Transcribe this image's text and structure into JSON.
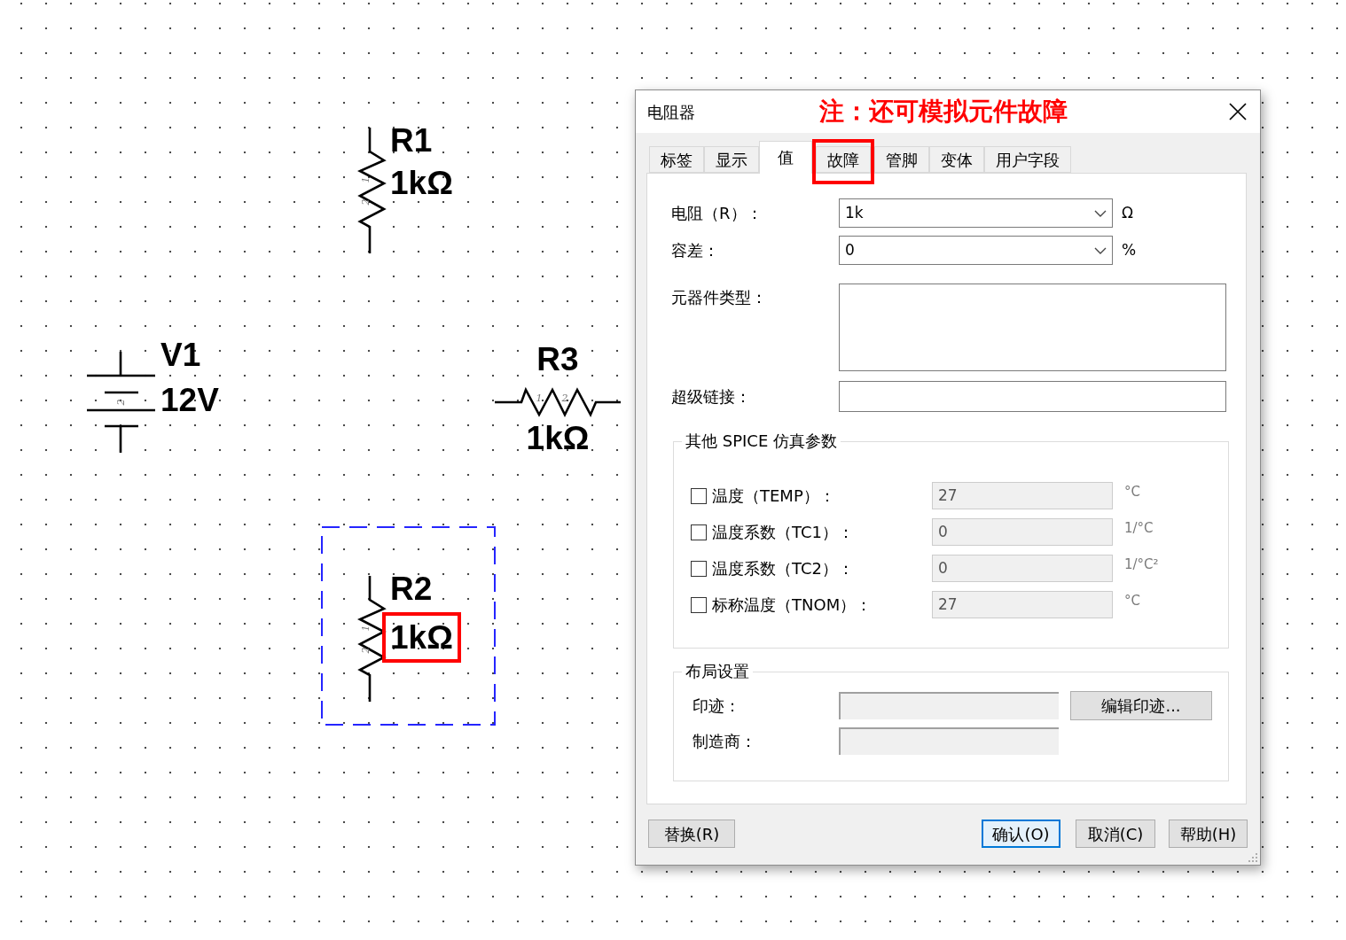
{
  "schematic": {
    "components": [
      {
        "kind": "resistor_vertical",
        "ref": "R1",
        "value": "1kΩ",
        "pins": [
          "1",
          "2"
        ],
        "selected": false,
        "value_highlighted": false
      },
      {
        "kind": "battery",
        "ref": "V1",
        "value": "12V",
        "pins": [
          "2"
        ],
        "selected": false,
        "value_highlighted": false
      },
      {
        "kind": "resistor_horizontal",
        "ref": "R3",
        "value": "1kΩ",
        "pins": [
          "1",
          "2"
        ],
        "selected": false,
        "value_highlighted": false
      },
      {
        "kind": "resistor_vertical",
        "ref": "R2",
        "value": "1kΩ",
        "pins": [
          "1",
          "2"
        ],
        "selected": true,
        "value_highlighted": true
      }
    ]
  },
  "dialog": {
    "title": "电阻器",
    "annotation": "注：还可模拟元件故障",
    "tabs": [
      {
        "label": "标签",
        "selected": false,
        "highlighted": false
      },
      {
        "label": "显示",
        "selected": false,
        "highlighted": false
      },
      {
        "label": "值",
        "selected": true,
        "highlighted": false
      },
      {
        "label": "故障",
        "selected": false,
        "highlighted": true
      },
      {
        "label": "管脚",
        "selected": false,
        "highlighted": false
      },
      {
        "label": "变体",
        "selected": false,
        "highlighted": false
      },
      {
        "label": "用户字段",
        "selected": false,
        "highlighted": false
      }
    ],
    "fields": [
      {
        "kind": "combo",
        "label": "电阻（R）：",
        "value": "1k",
        "unit": "Ω"
      },
      {
        "kind": "combo",
        "label": "容差：",
        "value": "0",
        "unit": "%"
      },
      {
        "kind": "textarea",
        "label": "元器件类型："
      },
      {
        "kind": "text",
        "label": "超级链接："
      }
    ],
    "spice_group": {
      "title": "其他 SPICE 仿真参数",
      "params": [
        {
          "label": "温度（TEMP）：",
          "checked": false,
          "disabled": true,
          "value": "27",
          "unit": "°C"
        },
        {
          "label": "温度系数（TC1）：",
          "checked": false,
          "disabled": true,
          "value": "0",
          "unit": "1/°C"
        },
        {
          "label": "温度系数（TC2）：",
          "checked": false,
          "disabled": true,
          "value": "0",
          "unit": "1/°C²"
        },
        {
          "label": "标称温度（TNOM）：",
          "checked": false,
          "disabled": true,
          "value": "27",
          "unit": "°C"
        }
      ]
    },
    "layout_group": {
      "title": "布局设置",
      "rows": [
        {
          "label": "印迹：",
          "disabled": true,
          "button": "编辑印迹..."
        },
        {
          "label": "制造商：",
          "disabled": true
        }
      ]
    },
    "buttons": [
      {
        "label": "替换(R)",
        "default": false
      },
      {
        "label": "确认(O)",
        "default": true
      },
      {
        "label": "取消(C)",
        "default": false
      },
      {
        "label": "帮助(H)",
        "default": false
      }
    ]
  }
}
